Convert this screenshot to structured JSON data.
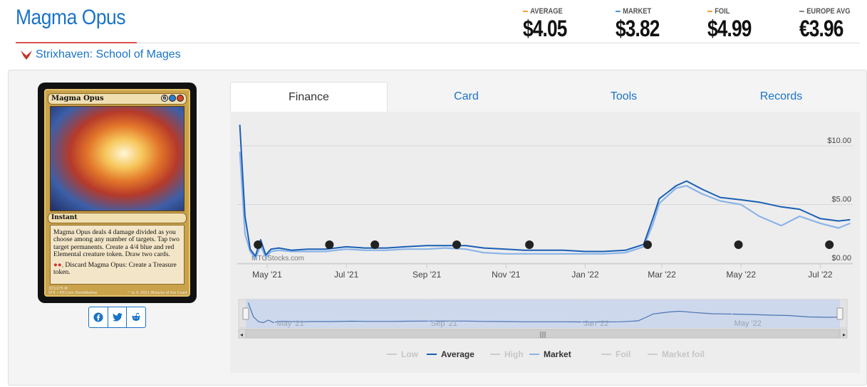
{
  "header": {
    "title": "Magma Opus",
    "set_name": "Strixhaven: School of Mages"
  },
  "prices": [
    {
      "label": "AVERAGE",
      "value": "$4.05",
      "color": "#f0a030"
    },
    {
      "label": "MARKET",
      "value": "$3.82",
      "color": "#4a90d9"
    },
    {
      "label": "FOIL",
      "value": "$4.99",
      "color": "#f0a030"
    },
    {
      "label": "EUROPE AVG",
      "value": "€3.96",
      "color": "#888888"
    }
  ],
  "card": {
    "name": "Magma Opus",
    "type_line": "Instant",
    "rules_1": "Magma Opus deals 4 damage divided as you choose among any number of targets. Tap two target permanents. Create a 4/4 blue and red Elemental creature token. Draw two cards.",
    "rules_2": "Discard Magma Opus: Create a Treasure token.",
    "collector": "203/275 M",
    "set_lang": "STX • EN",
    "artist": "Lixin Shmidkaline",
    "copyright": "™ & © 2021 Wizards of the Coast"
  },
  "share_icons": [
    "facebook-icon",
    "twitter-icon",
    "reddit-icon"
  ],
  "tabs": [
    {
      "label": "Finance",
      "active": true
    },
    {
      "label": "Card",
      "active": false
    },
    {
      "label": "Tools",
      "active": false
    },
    {
      "label": "Records",
      "active": false
    }
  ],
  "chart_data": {
    "type": "line",
    "watermark": "MTGStocks.com",
    "x_ticks": [
      "May '21",
      "Jul '21",
      "Sep '21",
      "Nov '21",
      "Jan '22",
      "Mar '22",
      "May '22",
      "Jul '22"
    ],
    "navigator_ticks": [
      "May '21",
      "Sep '21",
      "Jan '22",
      "May '22"
    ],
    "y_ticks": [
      "$0.00",
      "$5.00",
      "$10.00"
    ],
    "ylim": [
      0,
      12
    ],
    "grid": true,
    "legend_position": "bottom-center",
    "legend": [
      {
        "name": "Low",
        "active": false
      },
      {
        "name": "Average",
        "active": true
      },
      {
        "name": "High",
        "active": false
      },
      {
        "name": "Market",
        "active": true
      },
      {
        "name": "Foil",
        "active": false
      },
      {
        "name": "Market foil",
        "active": false
      }
    ],
    "x": [
      "2021-04-10",
      "2021-04-14",
      "2021-04-18",
      "2021-04-22",
      "2021-04-26",
      "2021-04-30",
      "2021-05-04",
      "2021-05-10",
      "2021-05-20",
      "2021-06-01",
      "2021-06-15",
      "2021-07-01",
      "2021-07-15",
      "2021-08-01",
      "2021-08-15",
      "2021-09-01",
      "2021-09-15",
      "2021-10-01",
      "2021-10-15",
      "2021-11-01",
      "2021-11-15",
      "2021-12-01",
      "2021-12-15",
      "2022-01-01",
      "2022-01-15",
      "2022-02-01",
      "2022-02-15",
      "2022-02-22",
      "2022-02-27",
      "2022-03-05",
      "2022-03-12",
      "2022-03-20",
      "2022-04-01",
      "2022-04-15",
      "2022-05-01",
      "2022-05-15",
      "2022-06-01",
      "2022-06-15",
      "2022-07-01",
      "2022-07-15",
      "2022-07-24"
    ],
    "series": [
      {
        "name": "Average",
        "color": "#1a5fb4",
        "values": [
          11.8,
          4.0,
          1.2,
          0.6,
          2.0,
          0.7,
          1.2,
          1.3,
          1.1,
          1.2,
          1.2,
          1.4,
          1.3,
          1.3,
          1.4,
          1.5,
          1.5,
          1.5,
          1.3,
          1.2,
          1.1,
          1.1,
          1.1,
          1.0,
          1.0,
          1.1,
          1.6,
          3.8,
          5.5,
          6.0,
          6.6,
          7.0,
          6.3,
          5.6,
          5.4,
          5.2,
          4.8,
          4.6,
          3.8,
          3.6,
          3.7
        ]
      },
      {
        "name": "Market",
        "color": "#8ab4e8",
        "values": [
          9.5,
          2.5,
          1.0,
          0.4,
          1.5,
          0.5,
          1.0,
          1.1,
          1.0,
          1.0,
          1.0,
          1.2,
          1.1,
          1.1,
          1.2,
          1.2,
          1.3,
          1.2,
          0.9,
          0.8,
          0.8,
          0.8,
          0.8,
          0.8,
          0.8,
          0.9,
          1.4,
          3.3,
          5.1,
          5.7,
          6.4,
          6.6,
          5.9,
          5.3,
          5.0,
          4.0,
          3.2,
          4.0,
          3.4,
          3.0,
          3.4
        ]
      }
    ]
  }
}
